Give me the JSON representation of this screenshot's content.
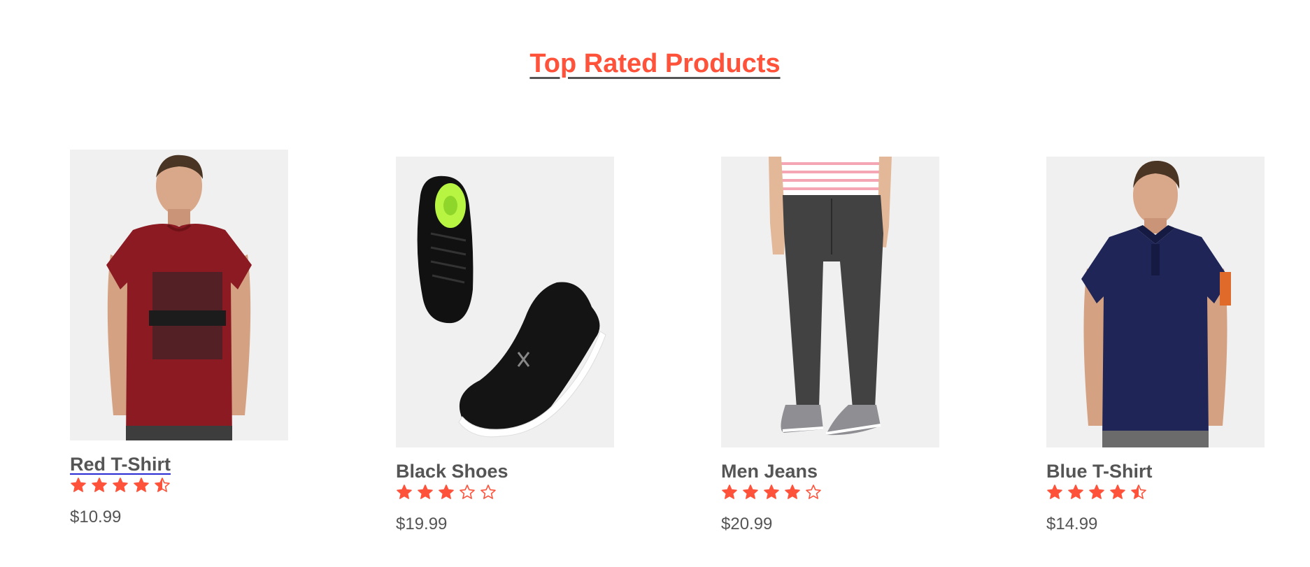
{
  "heading": "Top Rated Products",
  "colors": {
    "accent": "#ff523b",
    "text": "#555555",
    "image_bg": "#f0f0f0"
  },
  "products": [
    {
      "name": "Red T-Shirt",
      "rating": 4.5,
      "price": "$10.99",
      "image_icon": "red-tshirt-photo"
    },
    {
      "name": "Black Shoes",
      "rating": 3,
      "price": "$19.99",
      "image_icon": "black-shoes-photo"
    },
    {
      "name": "Men Jeans",
      "rating": 4,
      "price": "$20.99",
      "image_icon": "men-jeans-photo"
    },
    {
      "name": "Blue T-Shirt",
      "rating": 4.5,
      "price": "$14.99",
      "image_icon": "blue-tshirt-photo"
    }
  ]
}
